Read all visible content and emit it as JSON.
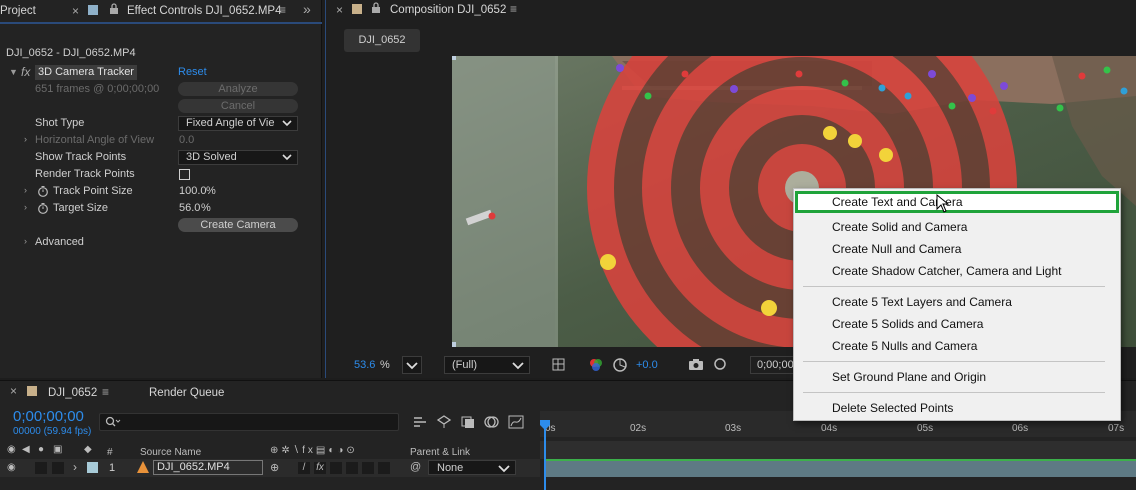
{
  "effect_controls": {
    "project_tab": "Project",
    "panel_tab": "Effect Controls DJI_0652.MP4",
    "clip_title": "DJI_0652 - DJI_0652.MP4",
    "effect_name": "3D Camera Tracker",
    "reset_label": "Reset",
    "frames_info": "651 frames @ 0;00;00;00",
    "analyze_label": "Analyze",
    "cancel_label": "Cancel",
    "shot_type_label": "Shot Type",
    "shot_type_value": "Fixed Angle of Vie",
    "hfov_label": "Horizontal Angle of View",
    "hfov_value": "0.0",
    "show_track_points_label": "Show Track Points",
    "show_track_points_value": "3D Solved",
    "render_track_points_label": "Render Track Points",
    "track_point_size_label": "Track Point Size",
    "track_point_size_value": "100.0",
    "target_size_label": "Target Size",
    "target_size_value": "56.0",
    "percent": "%",
    "create_camera_label": "Create Camera",
    "advanced_label": "Advanced"
  },
  "composition": {
    "tab_title": "Composition DJI_0652",
    "chip_label": "DJI_0652",
    "zoom_value": "53.6",
    "zoom_unit": "%",
    "resolution": "(Full)",
    "exposure": "+0.0",
    "timecode_partial": "0;00;00"
  },
  "context_menu": {
    "items": [
      "Create Text and Camera",
      "Create Solid and Camera",
      "Create Null and Camera",
      "Create Shadow Catcher, Camera and Light",
      "Create 5 Text Layers and Camera",
      "Create 5 Solids and Camera",
      "Create 5 Nulls and Camera",
      "Set Ground Plane and Origin",
      "Delete Selected Points"
    ]
  },
  "timeline": {
    "comp_tab": "DJI_0652",
    "render_queue_tab": "Render Queue",
    "timecode": "0;00;00;00",
    "frame_info": "00000 (59.94 fps)",
    "search_placeholder": "",
    "col_hash": "#",
    "col_source_name": "Source Name",
    "col_parent": "Parent & Link",
    "layer_number": "1",
    "layer_name": "DJI_0652.MP4",
    "parent_value": "None",
    "ruler_labels": [
      "0s",
      "02s",
      "03s",
      "04s",
      "05s",
      "06s",
      "07s"
    ]
  },
  "colors": {
    "accent_blue": "#2d8ceb",
    "menu_highlight_border": "#1fa33a",
    "target_red": "#d9433d"
  }
}
